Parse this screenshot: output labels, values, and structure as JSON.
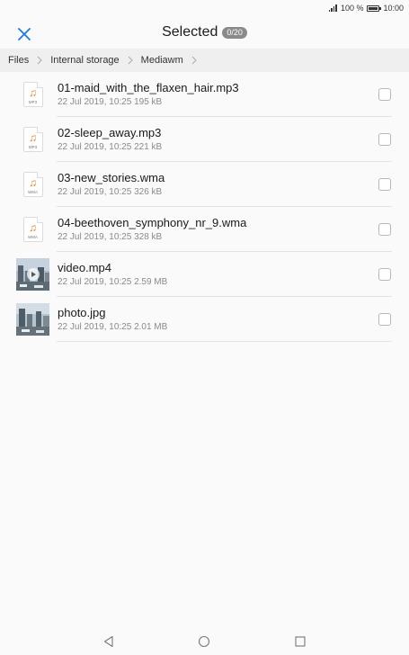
{
  "status_bar": {
    "battery_text": "100 %",
    "time": "10:00"
  },
  "header": {
    "title": "Selected",
    "count_badge": "0/20",
    "accent_color": "#1a7ce0"
  },
  "breadcrumb": [
    "Files",
    "Internal storage",
    "Mediawm"
  ],
  "files": [
    {
      "name": "01-maid_with_the_flaxen_hair.mp3",
      "meta": "22 Jul 2019, 10:25 195 kB",
      "type": "audio",
      "ext": "MP3"
    },
    {
      "name": "02-sleep_away.mp3",
      "meta": "22 Jul 2019, 10:25 221 kB",
      "type": "audio",
      "ext": "MP3"
    },
    {
      "name": "03-new_stories.wma",
      "meta": "22 Jul 2019, 10:25 326 kB",
      "type": "audio",
      "ext": "WMA"
    },
    {
      "name": "04-beethoven_symphony_nr_9.wma",
      "meta": "22 Jul 2019, 10:25 328 kB",
      "type": "audio",
      "ext": "WMA"
    },
    {
      "name": "video.mp4",
      "meta": "22 Jul 2019, 10:25 2.59 MB",
      "type": "video",
      "ext": ""
    },
    {
      "name": "photo.jpg",
      "meta": "22 Jul 2019, 10:25 2.01 MB",
      "type": "image",
      "ext": ""
    }
  ],
  "icons": {
    "close": "close-icon",
    "audio": "music-note-icon",
    "back": "back-triangle-icon",
    "home": "home-circle-icon",
    "recents": "recents-square-icon"
  }
}
